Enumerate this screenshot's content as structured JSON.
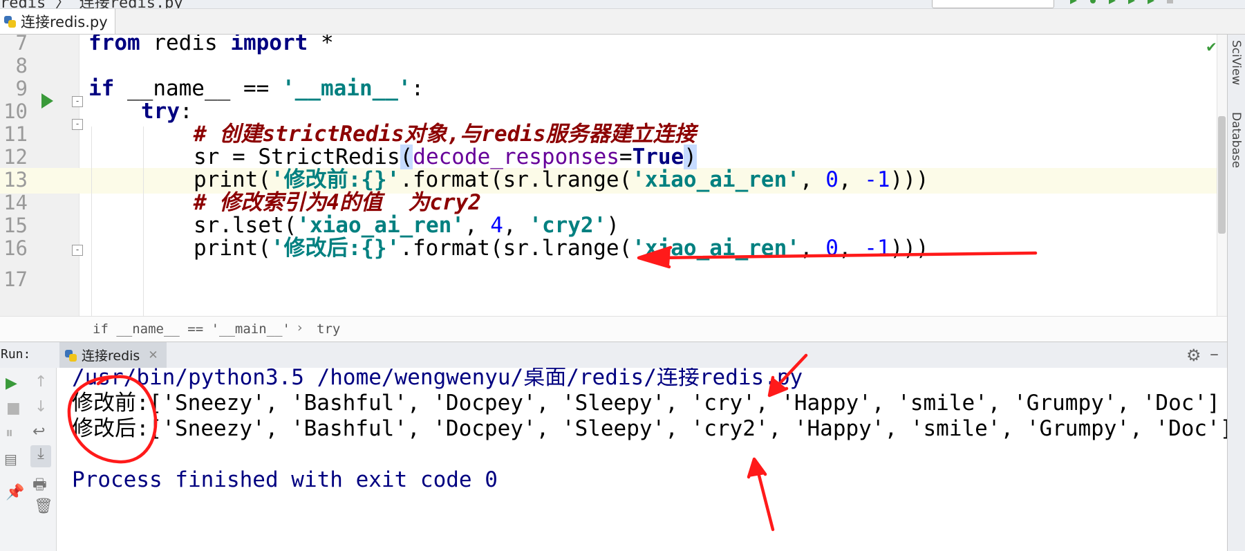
{
  "top": {
    "crumb": "redis  〉 连接redis.py",
    "run_config": "连接redis"
  },
  "file_tab": {
    "label": "连接redis.py",
    "icon": "python-file-icon"
  },
  "editor": {
    "line_numbers": [
      "7",
      "8",
      "9",
      "10",
      "11",
      "12",
      "13",
      "14",
      "15",
      "16",
      "17"
    ],
    "l7": {
      "from": "from",
      "mod": " redis ",
      "import": "import",
      "star": " *"
    },
    "l9": {
      "if": "if",
      "name": " __name__ == ",
      "main": "'__main__'",
      "colon": ":"
    },
    "l10": {
      "try": "try",
      "colon": ":"
    },
    "l11": "# 创建strictRedis对象,与redis服务器建立连接",
    "l12": {
      "a": "sr = StrictRedis",
      "paren_open": "(",
      "param": "decode_responses",
      "eq": "=",
      "true": "True",
      "paren_close": ")"
    },
    "l13": {
      "a": "print(",
      "s1": "'修改前:{}'",
      "b": ".format(sr.lrange(",
      "s2": "'xiao_ai_ren'",
      "c": ", ",
      "n0": "0",
      "d": ", ",
      "n1": "-1",
      "e": ")))"
    },
    "l14": "# 修改索引为4的值  为cry2",
    "l15": {
      "a": "sr.lset(",
      "s1": "'xiao_ai_ren'",
      "b": ", ",
      "n4": "4",
      "c": ", ",
      "s2": "'cry2'",
      "d": ")"
    },
    "l16": {
      "a": "print(",
      "s1": "'修改后:{}'",
      "b": ".format(sr.lrange(",
      "s2": "'xiao_ai_ren'",
      "c": ", ",
      "n0": "0",
      "d": ", ",
      "n1": "-1",
      "e": ")))"
    }
  },
  "breadcrumb": {
    "a": "if __name__ == '__main__'",
    "sep": "›",
    "b": "try"
  },
  "run": {
    "label": "Run:",
    "tab": "连接redis",
    "console": {
      "cmd": "/usr/bin/python3.5 /home/wengwenyu/桌面/redis/连接redis.py",
      "before_label": "修改前:",
      "before_list": "['Sneezy', 'Bashful', 'Docpey', 'Sleepy', 'cry', 'Happy', 'smile', 'Grumpy', 'Doc']",
      "after_label": "修改后:",
      "after_list": "['Sneezy', 'Bashful', 'Docpey', 'Sleepy', 'cry2', 'Happy', 'smile', 'Grumpy', 'Doc']",
      "exit": "Process finished with exit code 0"
    }
  },
  "right_tool": {
    "scview": "SciView",
    "database": "Database"
  },
  "colors": {
    "annotation": "#ff1a1a",
    "run_green": "#3a9a3a",
    "keyword": "#000080",
    "string": "#008080"
  }
}
